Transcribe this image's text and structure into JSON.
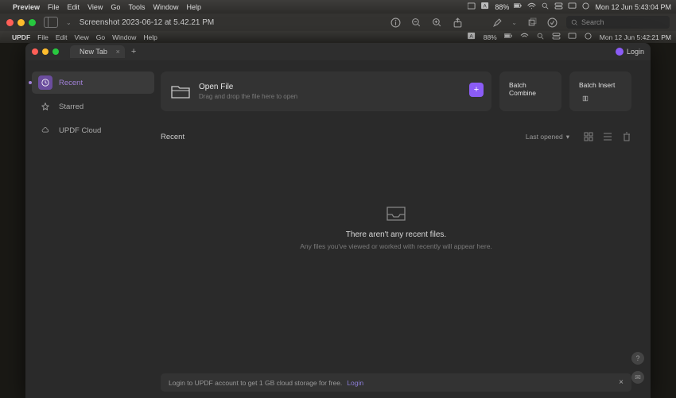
{
  "os_menubar": {
    "app": "Preview",
    "menus": [
      "File",
      "Edit",
      "View",
      "Go",
      "Tools",
      "Window",
      "Help"
    ],
    "battery": "88%",
    "datetime": "Mon 12 Jun  5:43:04 PM"
  },
  "preview_window": {
    "title": "Screenshot 2023-06-12 at 5.42.21 PM",
    "search_placeholder": "Search"
  },
  "inner_menubar": {
    "app": "UPDF",
    "menus": [
      "File",
      "Edit",
      "View",
      "Go",
      "Window",
      "Help"
    ],
    "battery": "88%",
    "datetime": "Mon 12 Jun  5:42:21 PM"
  },
  "updf": {
    "tab": {
      "label": "New Tab"
    },
    "login_label": "Login",
    "sidebar": {
      "items": [
        {
          "label": "Recent"
        },
        {
          "label": "Starred"
        },
        {
          "label": "UPDF Cloud"
        }
      ]
    },
    "cards": {
      "open_file": {
        "title": "Open File",
        "subtitle": "Drag and drop the file here to open"
      },
      "batch_combine": {
        "title": "Batch Combine"
      },
      "batch_insert": {
        "title": "Batch Insert"
      }
    },
    "recent": {
      "heading": "Recent",
      "sort_label": "Last opened",
      "empty_title": "There aren't any recent files.",
      "empty_sub": "Any files you've viewed or worked with recently will appear here."
    },
    "banner": {
      "text": "Login to UPDF account to get 1 GB cloud storage for free.",
      "link": "Login"
    }
  }
}
